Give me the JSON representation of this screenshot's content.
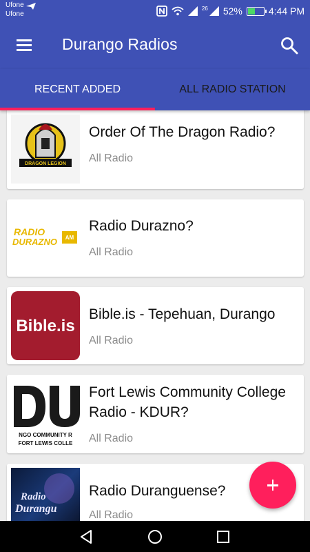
{
  "status_bar": {
    "carrier_1": "Ufone",
    "carrier_2": "Ufone",
    "network_label": "26",
    "battery": "52%",
    "battery_level": 0.52,
    "time": "4:44 PM"
  },
  "app_bar": {
    "title": "Durango Radios",
    "menu_icon": "hamburger-menu-icon",
    "search_icon": "search-icon"
  },
  "tabs": [
    {
      "label": "RECENT ADDED",
      "active": true
    },
    {
      "label": "ALL RADIO STATION",
      "active": false
    }
  ],
  "stations": [
    {
      "title": "Order Of The Dragon Radio?",
      "subtitle": "All Radio",
      "logo_text": "Dragon Legion"
    },
    {
      "title": "Radio Durazno?",
      "subtitle": "All Radio",
      "logo_text": "RADIO DURAZNO"
    },
    {
      "title": "Bible.is - Tepehuan, Durango",
      "subtitle": "All Radio",
      "logo_text": "Bible.is"
    },
    {
      "title": "Fort Lewis Community College Radio - KDUR?",
      "subtitle": "All Radio",
      "logo_text": "DU"
    },
    {
      "title": "Radio Duranguense?",
      "subtitle": "All Radio",
      "logo_text": "Radio Durangu"
    }
  ],
  "fab": {
    "icon": "plus-icon"
  },
  "nav_bar": {
    "back_icon": "back-triangle-icon",
    "home_icon": "home-circle-icon",
    "recents_icon": "recents-square-icon"
  },
  "colors": {
    "primary": "#3f51b5",
    "accent": "#ff1f5c",
    "background": "#ececec"
  }
}
